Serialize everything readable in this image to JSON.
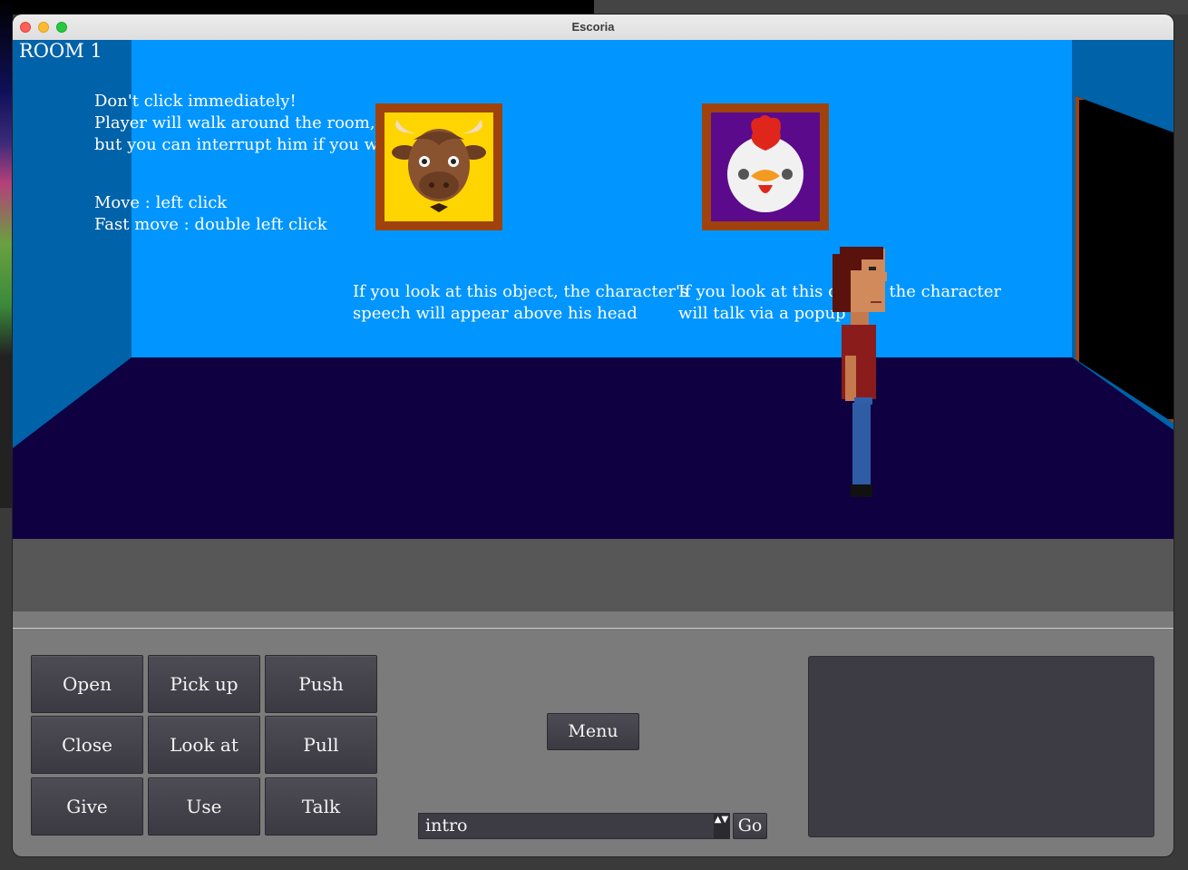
{
  "window": {
    "title": "Escoria"
  },
  "scene": {
    "room_label": "ROOM 1",
    "hint_intro": [
      "Don't click immediately!",
      "Player will walk around the room,",
      "but you can interrupt him if you want."
    ],
    "hint_controls": [
      "Move : left click",
      "Fast move : double left click"
    ],
    "bull_caption": [
      "If you look at this object, the character's",
      "speech will appear above his head"
    ],
    "chicken_caption": [
      "If you look at this object, the character",
      "will talk via a popup"
    ]
  },
  "verbs": {
    "open": "Open",
    "pick_up": "Pick up",
    "push": "Push",
    "close": "Close",
    "look_at": "Look at",
    "pull": "Pull",
    "give": "Give",
    "use": "Use",
    "talk": "Talk"
  },
  "menu_label": "Menu",
  "scene_select": {
    "value": "intro",
    "go_label": "Go",
    "arrow": "▲▼"
  },
  "colors": {
    "back_wall": "#0095ff",
    "side_wall": "#0062a8",
    "floor": "#0f0042",
    "frame": "#a0420d",
    "bull_bg": "#ffd500",
    "chicken_bg": "#5c0a8c",
    "button": "#44434b"
  }
}
